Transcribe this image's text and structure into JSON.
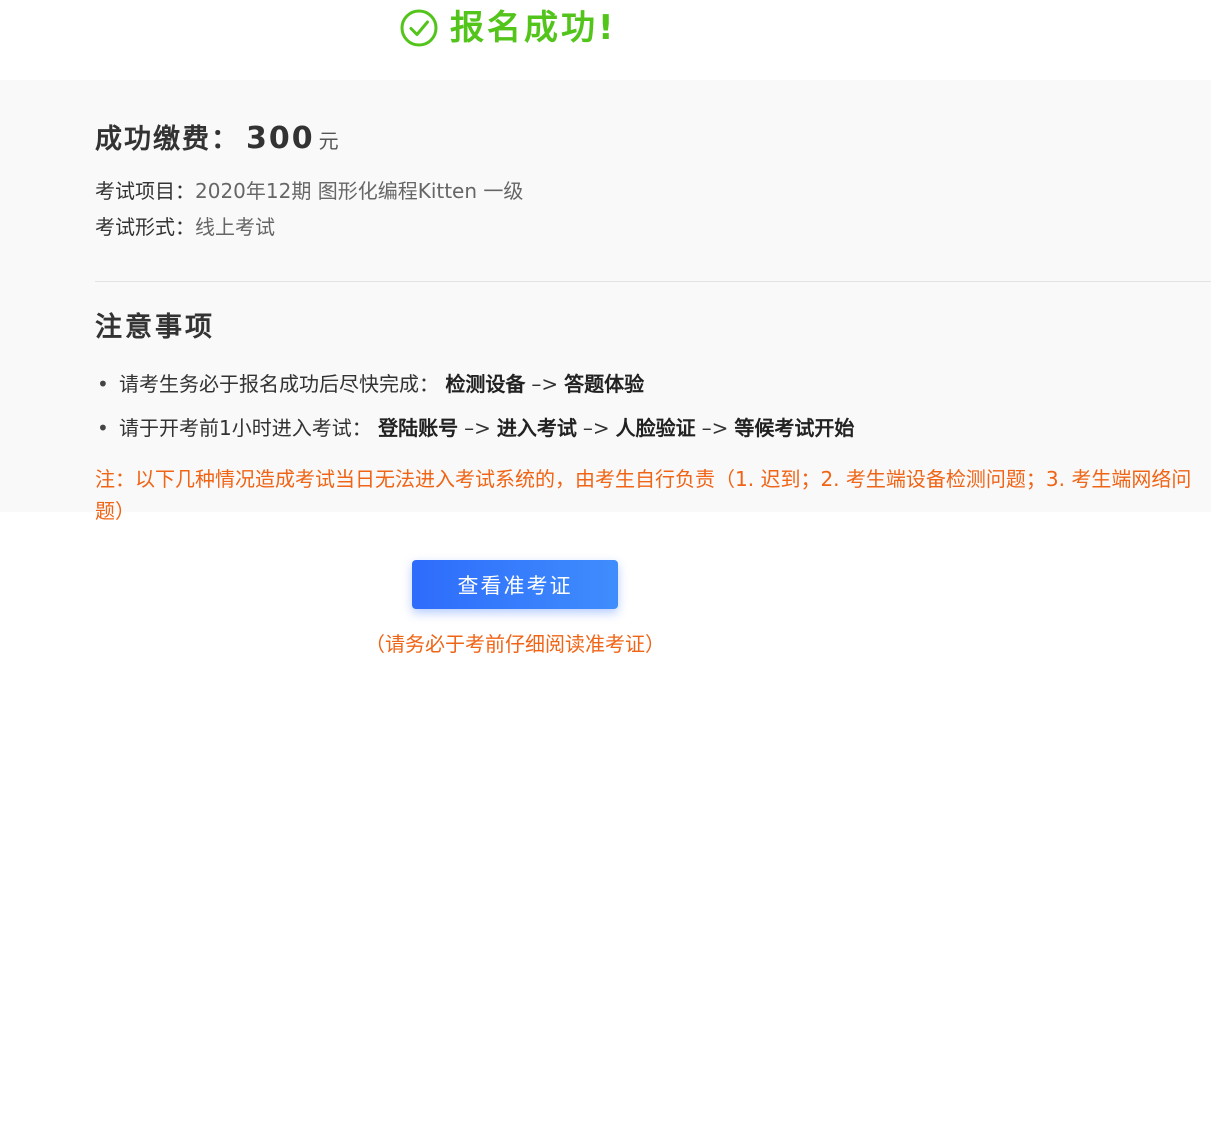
{
  "header": {
    "icon": "check-circle-icon",
    "title": "报名成功!",
    "color": "#52c41a"
  },
  "payment": {
    "label": "成功缴费：",
    "amount": "300",
    "unit": "元"
  },
  "exam": {
    "project_label": "考试项目：",
    "project_value": "2020年12期 图形化编程Kitten 一级",
    "format_label": "考试形式：",
    "format_value": "线上考试"
  },
  "notice": {
    "title": "注意事项",
    "bullet": "•",
    "arrow": "–>",
    "items": [
      {
        "text": "请考生务必于报名成功后尽快完成：",
        "steps": [
          "检测设备",
          "答题体验"
        ]
      },
      {
        "text": "请于开考前1小时进入考试：",
        "steps": [
          "登陆账号",
          "进入考试",
          "人脸验证",
          "等候考试开始"
        ]
      }
    ],
    "warning": "注：以下几种情况造成考试当日无法进入考试系统的，由考生自行负责（1. 迟到；2. 考生端设备检测问题；3. 考生端网络问题）",
    "warning_color": "#f06416"
  },
  "actions": {
    "view_admission_label": "查看准考证",
    "view_admission_hint": "（请务必于考前仔细阅读准考证）",
    "button_color": "#2e6cfb"
  }
}
